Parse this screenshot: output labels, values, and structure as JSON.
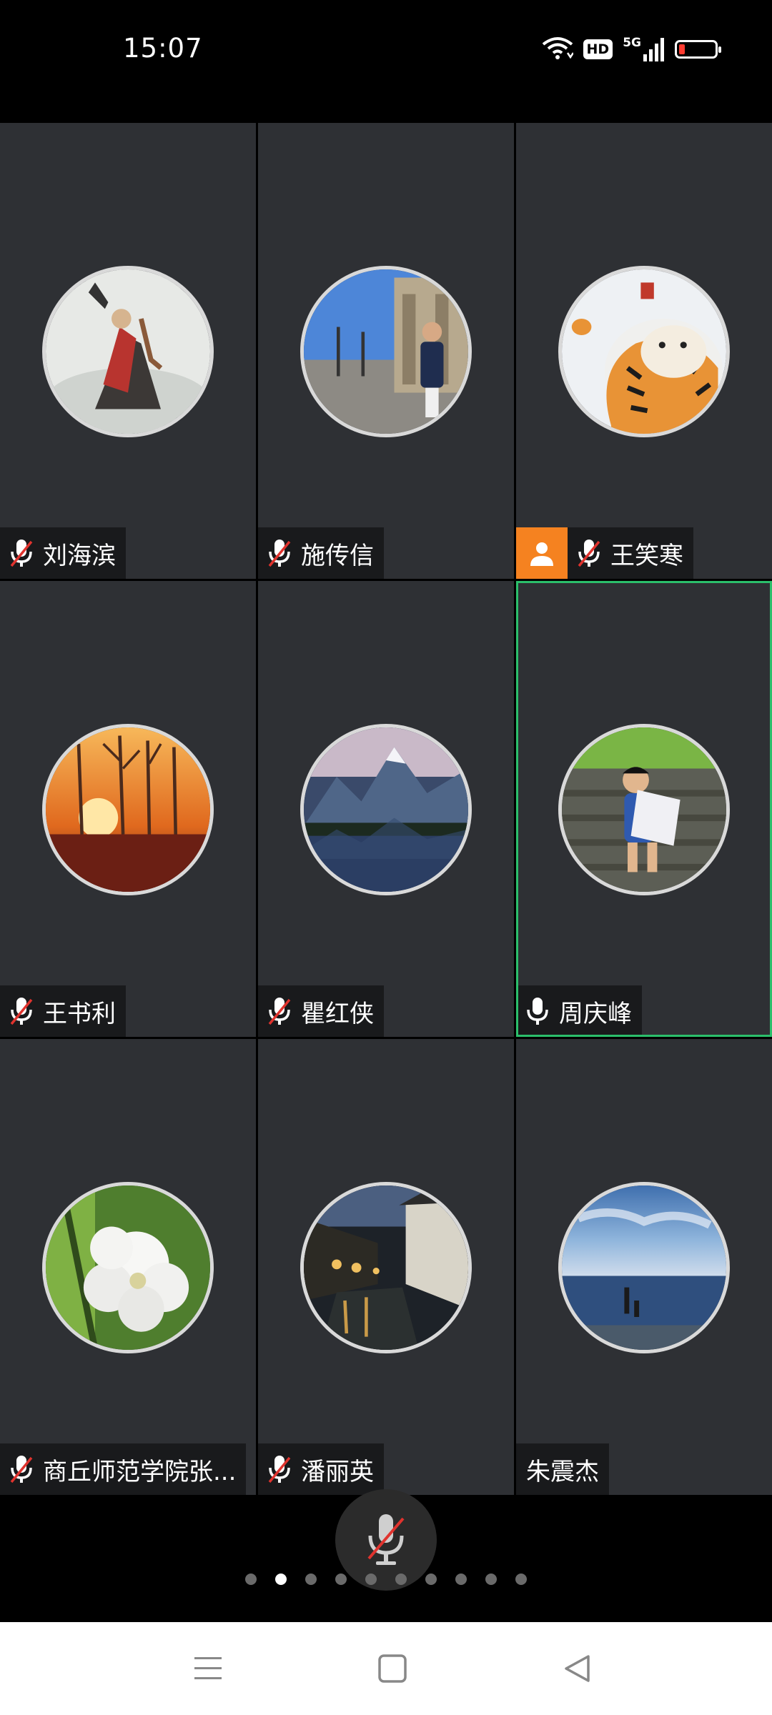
{
  "status_bar": {
    "time": "15:07",
    "hd_label": "HD",
    "network_label": "5G",
    "icons": [
      "wifi-icon",
      "hd-icon",
      "signal-5g-icon",
      "battery-low-icon"
    ],
    "battery_level": 0.1,
    "battery_color": "#ff3b30"
  },
  "participants": [
    {
      "name": "刘海滨",
      "mic": "muted",
      "avatar": "monkey-king-painting"
    },
    {
      "name": "施传信",
      "mic": "muted",
      "avatar": "man-in-street-photo"
    },
    {
      "name": "王笑寒",
      "mic": "muted",
      "avatar": "tiger-painting",
      "host": true
    },
    {
      "name": "王书利",
      "mic": "muted",
      "avatar": "sunset-trees"
    },
    {
      "name": "瞿红侠",
      "mic": "muted",
      "avatar": "snowy-mountain-lake"
    },
    {
      "name": "周庆峰",
      "mic": "on",
      "avatar": "boy-with-book",
      "active_speaker": true
    },
    {
      "name": "商丘师范学院张...",
      "mic": "muted",
      "avatar": "white-flower"
    },
    {
      "name": "潘丽英",
      "mic": "muted",
      "avatar": "night-canal-town"
    },
    {
      "name": "朱震杰",
      "mic": "none",
      "avatar": "sea-sky-people"
    }
  ],
  "controls": {
    "mic_button_icon": "mic-muted-icon",
    "page_count": 10,
    "current_page": 2
  },
  "nav_bar": {
    "icons": [
      "menu-icon",
      "home-icon",
      "back-icon"
    ]
  },
  "colors": {
    "tile_bg": "#2e3034",
    "active_border": "#2bbf6b",
    "host_badge": "#f58220",
    "muted_slash": "#e0332e"
  }
}
